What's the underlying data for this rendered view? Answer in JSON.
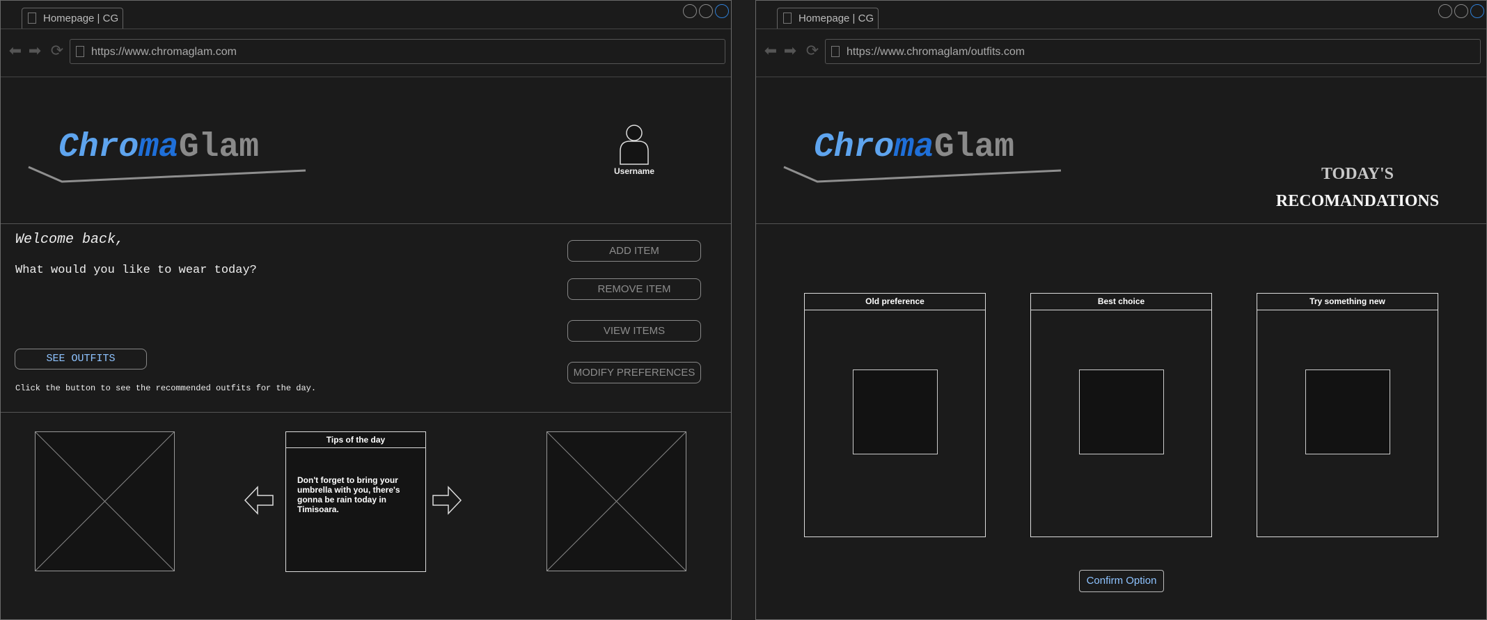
{
  "colors": {
    "accent_link": "#8ec3ff",
    "logo_light_blue": "#5ea4ee",
    "logo_blue": "#1f6fd8",
    "logo_gray": "#8a8a8a",
    "window_active_button": "#2f7fd6"
  },
  "window1": {
    "tab_title": "Homepage | CG",
    "url": "https://www.chromaglam.com",
    "logo": {
      "part1": "Chro",
      "part2": "ma",
      "part3": "Glam"
    },
    "user": {
      "label": "Username",
      "icon": "user-avatar-icon"
    },
    "welcome": "Welcome back,",
    "question": "What would you like to wear today?",
    "see_outfits": "SEE OUTFITS",
    "hint": "Click the button to see the recommended outfits for the day.",
    "actions": [
      "ADD ITEM",
      "REMOVE ITEM",
      "VIEW ITEMS",
      "MODIFY PREFERENCES"
    ],
    "tips": {
      "title": "Tips of the day",
      "text": "Don't forget to bring your umbrella with you, there's gonna be rain today in Timisoara."
    }
  },
  "window2": {
    "tab_title": "Homepage | CG",
    "url": "https://www.chromaglam/outfits.com",
    "logo": {
      "part1": "Chro",
      "part2": "ma",
      "part3": "Glam"
    },
    "title_line1": "TODAY'S",
    "title_line2": "RECOMANDATIONS",
    "cards": [
      "Old preference",
      "Best choice",
      "Try something new"
    ],
    "confirm": "Confirm Option"
  }
}
